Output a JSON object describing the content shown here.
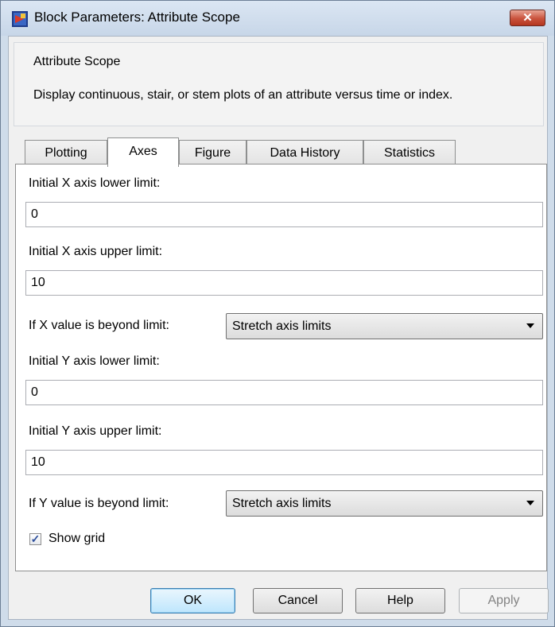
{
  "window": {
    "title": "Block Parameters: Attribute Scope",
    "close_glyph": "✕"
  },
  "group": {
    "title": "Attribute Scope",
    "description": "Display continuous, stair, or stem plots of an attribute versus time or index."
  },
  "tabs": [
    {
      "label": "Plotting",
      "active": false
    },
    {
      "label": "Axes",
      "active": true
    },
    {
      "label": "Figure",
      "active": false
    },
    {
      "label": "Data History",
      "active": false
    },
    {
      "label": "Statistics",
      "active": false
    }
  ],
  "axes": {
    "x_lower": {
      "label": "Initial X axis lower limit:",
      "value": "0"
    },
    "x_upper": {
      "label": "Initial X axis upper limit:",
      "value": "10"
    },
    "x_beyond": {
      "label": "If X value is beyond limit:",
      "value": "Stretch axis limits"
    },
    "y_lower": {
      "label": "Initial Y axis lower limit:",
      "value": "0"
    },
    "y_upper": {
      "label": "Initial Y axis upper limit:",
      "value": "10"
    },
    "y_beyond": {
      "label": "If Y value is beyond limit:",
      "value": "Stretch axis limits"
    },
    "show_grid": {
      "label": "Show grid",
      "checked": true,
      "check_glyph": "✓"
    }
  },
  "buttons": {
    "ok": "OK",
    "cancel": "Cancel",
    "help": "Help",
    "apply": "Apply"
  }
}
